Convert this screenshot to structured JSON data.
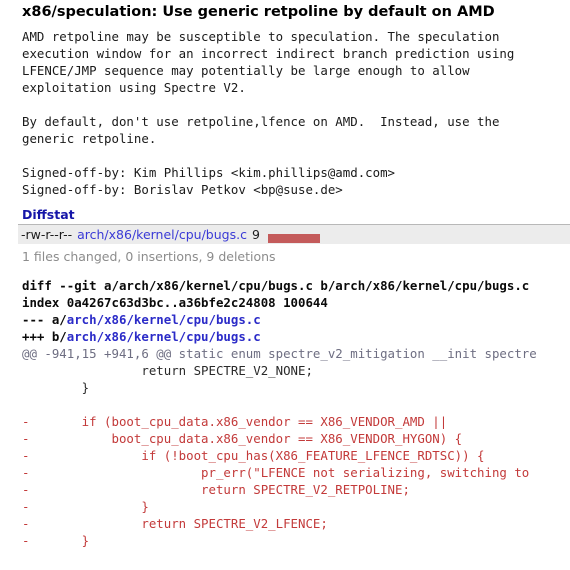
{
  "commit": {
    "title": "x86/speculation: Use generic retpoline by default on AMD",
    "message": "AMD retpoline may be susceptible to speculation. The speculation\nexecution window for an incorrect indirect branch prediction using\nLFENCE/JMP sequence may potentially be large enough to allow\nexploitation using Spectre V2.\n\nBy default, don't use retpoline,lfence on AMD.  Instead, use the\ngeneric retpoline.\n\nSigned-off-by: Kim Phillips <kim.phillips@amd.com>\nSigned-off-by: Borislav Petkov <bp@suse.de>"
  },
  "diffstat": {
    "heading": "Diffstat",
    "rows": [
      {
        "mode": "-rw-r--r--",
        "file": "arch/x86/kernel/cpu/bugs.c",
        "count": "9",
        "deletions_width": 52,
        "insertions_width": 0
      }
    ],
    "summary": "1 files changed, 0 insertions, 9 deletions"
  },
  "diff": {
    "lines": [
      {
        "kind": "head",
        "prefix": "diff --git a/arch/x86/kernel/cpu/bugs.c b/arch/x86/kernel/cpu/bugs.c",
        "path": ""
      },
      {
        "kind": "head",
        "prefix": "index 0a4267c63d3bc..a36bfe2c24808 100644",
        "path": ""
      },
      {
        "kind": "head",
        "prefix": "--- a/",
        "path": "arch/x86/kernel/cpu/bugs.c"
      },
      {
        "kind": "head",
        "prefix": "+++ b/",
        "path": "arch/x86/kernel/cpu/bugs.c"
      },
      {
        "kind": "hunk",
        "text": "@@ -941,15 +941,6 @@ static enum spectre_v2_mitigation __init spectre"
      },
      {
        "kind": "ctx",
        "text": "                return SPECTRE_V2_NONE;"
      },
      {
        "kind": "ctx",
        "text": "        }"
      },
      {
        "kind": "ctx",
        "text": ""
      },
      {
        "kind": "del",
        "text": "-       if (boot_cpu_data.x86_vendor == X86_VENDOR_AMD ||"
      },
      {
        "kind": "del",
        "text": "-           boot_cpu_data.x86_vendor == X86_VENDOR_HYGON) {"
      },
      {
        "kind": "del",
        "text": "-               if (!boot_cpu_has(X86_FEATURE_LFENCE_RDTSC)) {"
      },
      {
        "kind": "del",
        "text": "-                       pr_err(\"LFENCE not serializing, switching to"
      },
      {
        "kind": "del",
        "text": "-                       return SPECTRE_V2_RETPOLINE;"
      },
      {
        "kind": "del",
        "text": "-               }"
      },
      {
        "kind": "del",
        "text": "-               return SPECTRE_V2_LFENCE;"
      },
      {
        "kind": "del",
        "text": "-       }"
      }
    ]
  }
}
